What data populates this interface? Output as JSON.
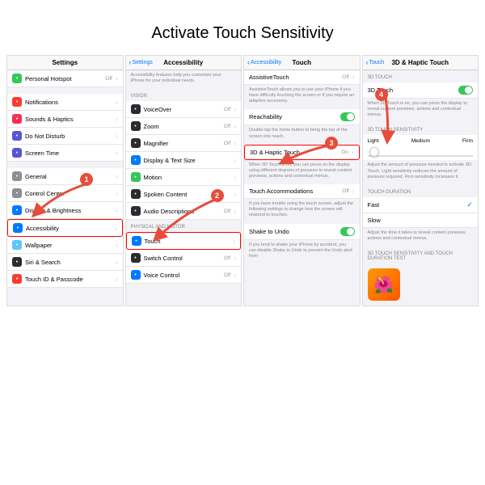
{
  "title": "Activate Touch Sensitivity",
  "p1": {
    "header": "Settings",
    "rows": [
      {
        "label": "Personal Hotspot",
        "detail": "Off",
        "icon": "#34c759"
      },
      {
        "label": "Notifications",
        "icon": "#ff3b30"
      },
      {
        "label": "Sounds & Haptics",
        "icon": "#ff2d55"
      },
      {
        "label": "Do Not Disturb",
        "icon": "#5856d6"
      },
      {
        "label": "Screen Time",
        "icon": "#5856d6"
      },
      {
        "label": "General",
        "icon": "#8e8e93"
      },
      {
        "label": "Control Center",
        "icon": "#8e8e93"
      },
      {
        "label": "Display & Brightness",
        "icon": "#007aff"
      },
      {
        "label": "Accessibility",
        "icon": "#007aff",
        "hl": true
      },
      {
        "label": "Wallpaper",
        "icon": "#5ac8fa"
      },
      {
        "label": "Siri & Search",
        "icon": "#2c2c2e"
      },
      {
        "label": "Touch ID & Passcode",
        "icon": "#ff3b30"
      }
    ]
  },
  "p2": {
    "back": "Settings",
    "header": "Accessibility",
    "desc": "Accessibility features help you customize your iPhone for your individual needs.",
    "sec1": "VISION",
    "vision": [
      {
        "label": "VoiceOver",
        "detail": "Off",
        "icon": "#2c2c2e"
      },
      {
        "label": "Zoom",
        "detail": "Off",
        "icon": "#2c2c2e"
      },
      {
        "label": "Magnifier",
        "detail": "Off",
        "icon": "#2c2c2e"
      },
      {
        "label": "Display & Text Size",
        "icon": "#007aff"
      },
      {
        "label": "Motion",
        "icon": "#34c759"
      },
      {
        "label": "Spoken Content",
        "icon": "#2c2c2e"
      },
      {
        "label": "Audio Descriptions",
        "detail": "Off",
        "icon": "#2c2c2e"
      }
    ],
    "sec2": "PHYSICAL AND MOTOR",
    "motor": [
      {
        "label": "Touch",
        "icon": "#007aff",
        "hl": true
      },
      {
        "label": "Switch Control",
        "detail": "Off",
        "icon": "#2c2c2e"
      },
      {
        "label": "Voice Control",
        "detail": "Off",
        "icon": "#007aff"
      }
    ]
  },
  "p3": {
    "back": "Accessibility",
    "header": "Touch",
    "r1": {
      "label": "AssistiveTouch",
      "detail": "Off"
    },
    "d1": "AssistiveTouch allows you to use your iPhone if you have difficulty touching the screen or if you require an adaptive accessory.",
    "r2": {
      "label": "Reachability"
    },
    "d2": "Double-tap the home button to bring the top of the screen into reach.",
    "r3": {
      "label": "3D & Haptic Touch",
      "detail": "On",
      "hl": true
    },
    "d3": "When 3D Touch is on, you can press on the display using different degrees of pressure to reveal content previews, actions and contextual menus.",
    "r4": {
      "label": "Touch Accommodations",
      "detail": "Off"
    },
    "d4": "If you have trouble using the touch screen, adjust the following settings to change how the screen will respond to touches.",
    "r5": {
      "label": "Shake to Undo"
    },
    "d5": "If you tend to shake your iPhone by accident, you can disable Shake to Undo to prevent the Undo alert from"
  },
  "p4": {
    "back": "Touch",
    "header": "3D & Haptic Touch",
    "sec1": "3D TOUCH",
    "r1": {
      "label": "3D Touch"
    },
    "d1": "When 3D Touch is on, you can press the display to reveal content previews, actions and contextual menus.",
    "sec2": "3D TOUCH SENSITIVITY",
    "seg": [
      "Light",
      "Medium",
      "Firm"
    ],
    "d2": "Adjust the amount of pressure needed to activate 3D Touch. Light sensitivity reduces the amount of pressure required. Firm sensitivity increases it.",
    "sec3": "TOUCH DURATION",
    "opts": [
      {
        "label": "Fast",
        "sel": true
      },
      {
        "label": "Slow"
      }
    ],
    "d3": "Adjust the time it takes to reveal content previews, actions and contextual menus.",
    "sec4": "3D TOUCH SENSITIVITY AND TOUCH DURATION TEST"
  },
  "badges": [
    "1",
    "2",
    "3",
    "4"
  ]
}
